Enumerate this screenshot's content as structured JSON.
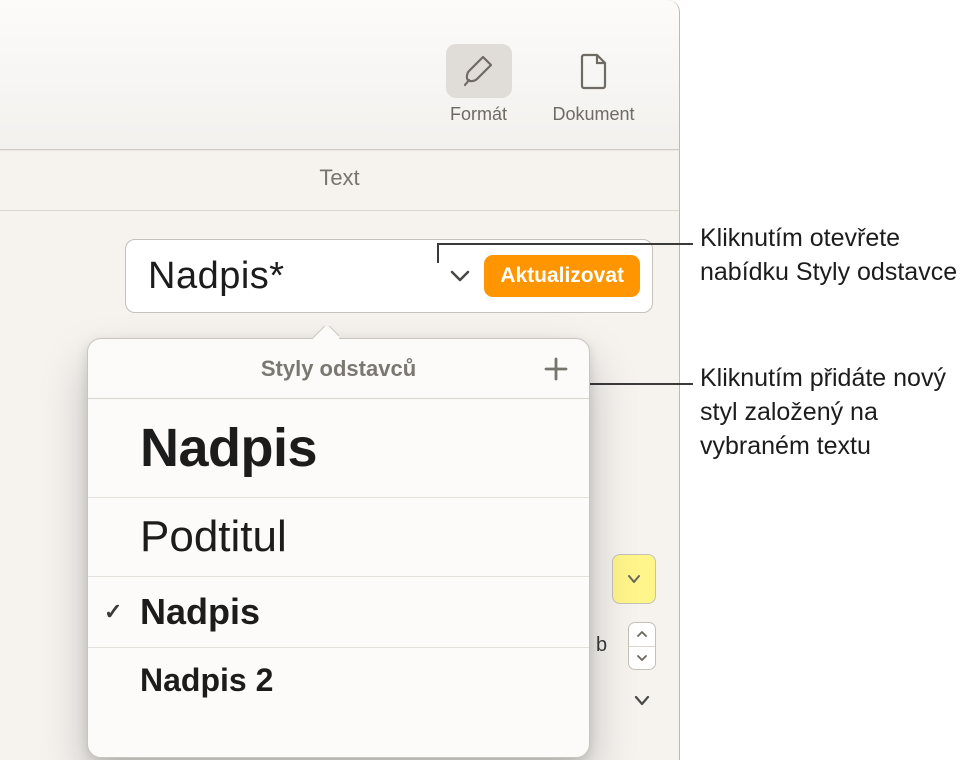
{
  "toolbar": {
    "format_label": "Formát",
    "document_label": "Dokument"
  },
  "inspector": {
    "tab_text": "Text",
    "current_style": "Nadpis*",
    "update_label": "Aktualizovat"
  },
  "popover": {
    "title": "Styly odstavců",
    "items": [
      {
        "label": "Nadpis",
        "class": "title",
        "selected": false
      },
      {
        "label": "Podtitul",
        "class": "subtitle",
        "selected": false
      },
      {
        "label": "Nadpis",
        "class": "heading",
        "selected": true
      },
      {
        "label": "Nadpis 2",
        "class": "heading2",
        "selected": false
      }
    ]
  },
  "peek": {
    "size_suffix": "b"
  },
  "callouts": {
    "open_menu": "Kliknutím otevřete nabídku Styly odstavce",
    "add_style": "Kliknutím přidáte nový styl založený na vybraném textu"
  }
}
